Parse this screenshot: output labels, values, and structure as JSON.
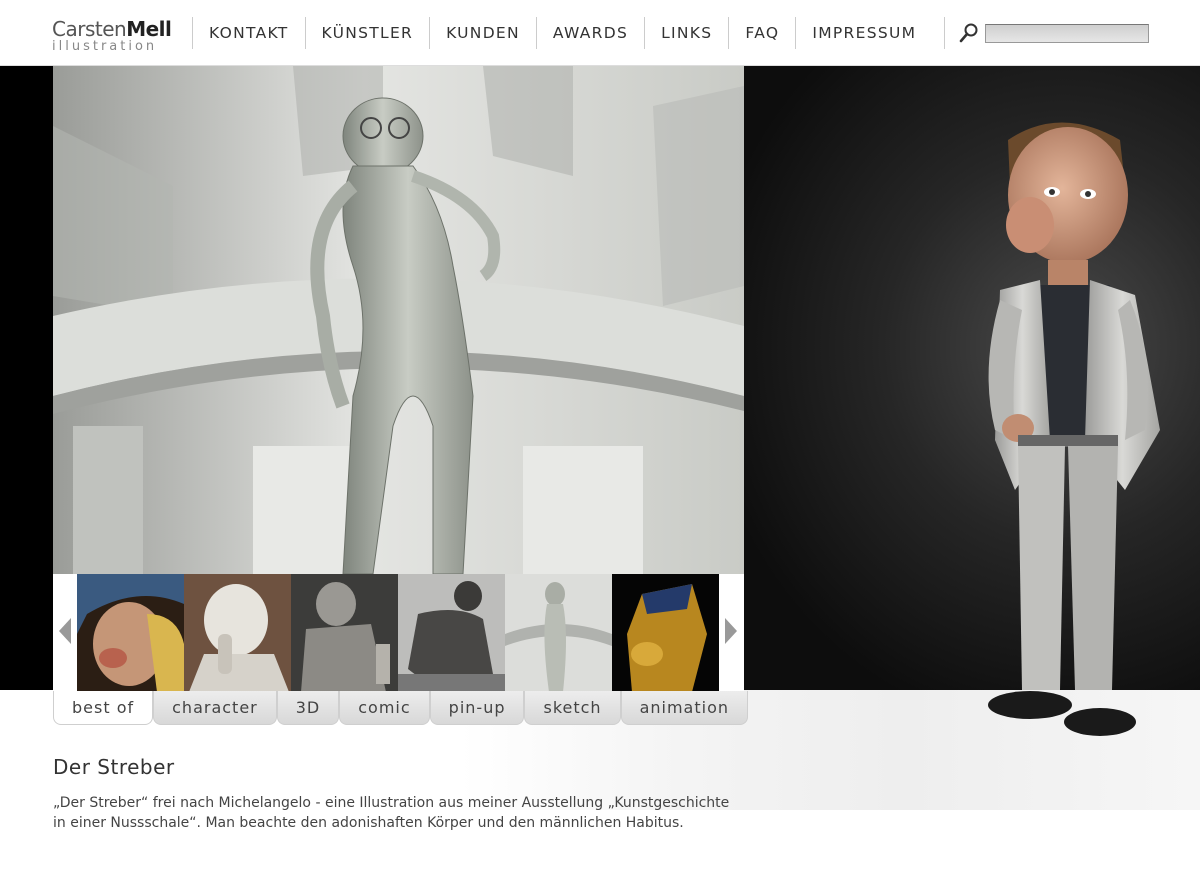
{
  "logo": {
    "name_light": "Carsten",
    "name_bold": "Mell",
    "subtitle": "illustration"
  },
  "nav": {
    "items": [
      "KONTAKT",
      "KÜNSTLER",
      "KUNDEN",
      "AWARDS",
      "LINKS",
      "FAQ",
      "IMPRESSUM"
    ]
  },
  "search": {
    "placeholder": "",
    "value": "",
    "icon": "search-icon"
  },
  "gallery": {
    "thumbnails": [
      "girl-with-pearl-earring-parody",
      "venus-bust-parody",
      "stone-sculpture-parody",
      "thinker-parody",
      "der-streber-statue",
      "golden-pharaoh-mask-parody"
    ],
    "selected_index": 4
  },
  "tabs": {
    "items": [
      "best of",
      "character",
      "3D",
      "comic",
      "pin-up",
      "sketch",
      "animation"
    ],
    "active": "best of"
  },
  "caption": {
    "title": "Der Streber",
    "text": "„Der Streber“ frei nach Michelangelo - eine Illustration aus meiner Ausstellung „Kunstgeschichte in einer Nussschale“. Man beachte den adonishaften Körper und den männlichen Habitus."
  },
  "colors": {
    "background": "#ffffff",
    "stage": "#000000",
    "text": "#333333",
    "tab": "#e0e0e0"
  }
}
